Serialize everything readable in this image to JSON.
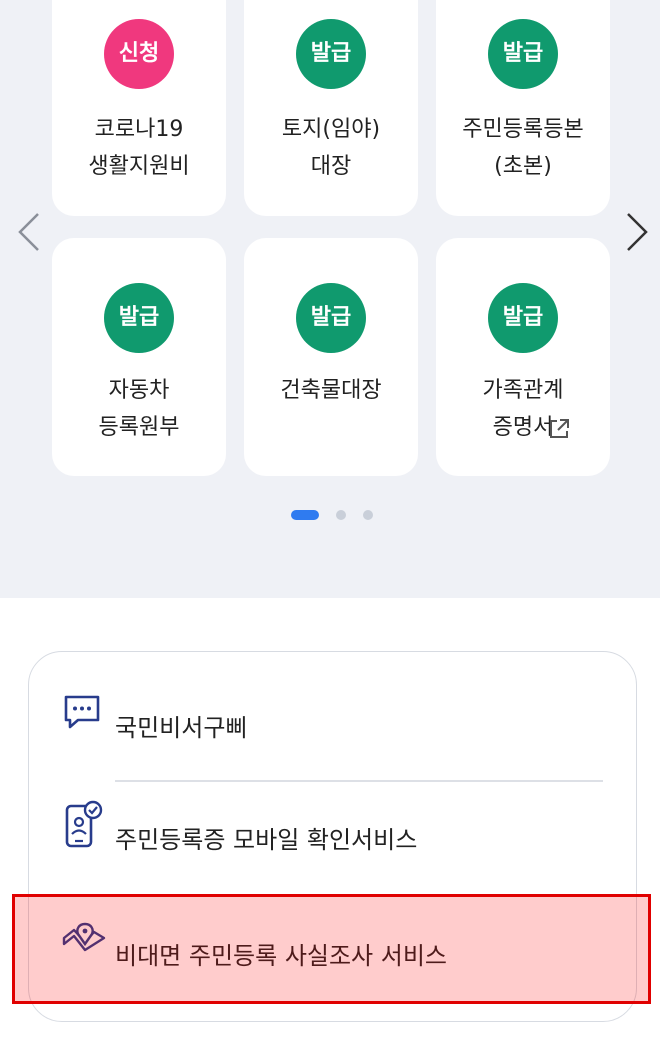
{
  "carousel": {
    "items": [
      {
        "badge": "신청",
        "badge_color": "#f0387e",
        "label": "코로나19\n생활지원비"
      },
      {
        "badge": "발급",
        "badge_color": "#109a6e",
        "label": "토지(임야)\n대장"
      },
      {
        "badge": "발급",
        "badge_color": "#109a6e",
        "label": "주민등록등본\n(초본)"
      },
      {
        "badge": "발급",
        "badge_color": "#109a6e",
        "label": "자동차\n등록원부"
      },
      {
        "badge": "발급",
        "badge_color": "#109a6e",
        "label": "건축물대장"
      },
      {
        "badge": "발급",
        "badge_color": "#109a6e",
        "label": "가족관계\n증명서",
        "icon": "external-link-icon"
      }
    ],
    "prev_icon": "chevron-left-icon",
    "next_icon": "chevron-right-icon",
    "page_count": 3,
    "active_page": 1
  },
  "services": [
    {
      "label": "국민비서구삐",
      "icon": "chat-bubble-icon"
    },
    {
      "label": "주민등록증 모바일 확인서비스",
      "icon": "mobile-id-check-icon"
    },
    {
      "label": "비대면 주민등록 사실조사 서비스",
      "icon": "map-pin-icon"
    }
  ],
  "colors": {
    "accent": "#2f7bf0",
    "apply_badge": "#f0387e",
    "issue_badge": "#109a6e",
    "icon_navy": "#283c8c"
  }
}
